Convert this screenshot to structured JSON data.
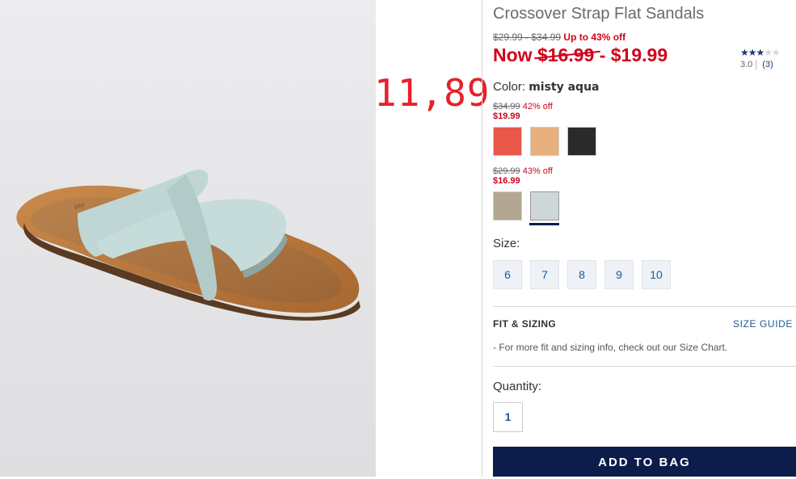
{
  "product": {
    "title": "Crossover Strap Flat Sandals",
    "price_range_original": "$29.99 - $34.99",
    "discount_text": "Up to 43% off",
    "now_prefix": "Now ",
    "now_low": "$16.99",
    "now_separator": " - ",
    "now_high": "$19.99"
  },
  "annotation": {
    "text": "11,89",
    "color": "#e8202a"
  },
  "rating": {
    "value": 3.0,
    "max": 5,
    "value_text": "3.0",
    "count_text": "(3)"
  },
  "color": {
    "label": "Color:",
    "selected": "misty aqua"
  },
  "swatch_groups": [
    {
      "was": "$34.99",
      "off": "42% off",
      "now": "$19.99",
      "swatches": [
        {
          "name": "coral",
          "color": "#e8574a"
        },
        {
          "name": "tan",
          "color": "#e8b07e"
        },
        {
          "name": "black",
          "color": "#2a2a2a"
        }
      ]
    },
    {
      "was": "$29.99",
      "off": "43% off",
      "now": "$16.99",
      "swatches": [
        {
          "name": "taupe",
          "color": "#b3a794"
        },
        {
          "name": "misty aqua",
          "color": "#cdd6d8",
          "selected": true
        }
      ]
    }
  ],
  "sizes": {
    "label": "Size:",
    "options": [
      "6",
      "7",
      "8",
      "9",
      "10"
    ]
  },
  "fit": {
    "title": "FIT & SIZING",
    "guide_link": "SIZE GUIDE",
    "note": "- For more fit and sizing info, check out our Size Chart."
  },
  "quantity": {
    "label": "Quantity:",
    "value": "1"
  },
  "cta": {
    "add_to_bag": "ADD TO BAG"
  },
  "colors": {
    "sale_red": "#d0021b",
    "navy": "#0c1d4b",
    "link_blue": "#1a5a9b"
  }
}
